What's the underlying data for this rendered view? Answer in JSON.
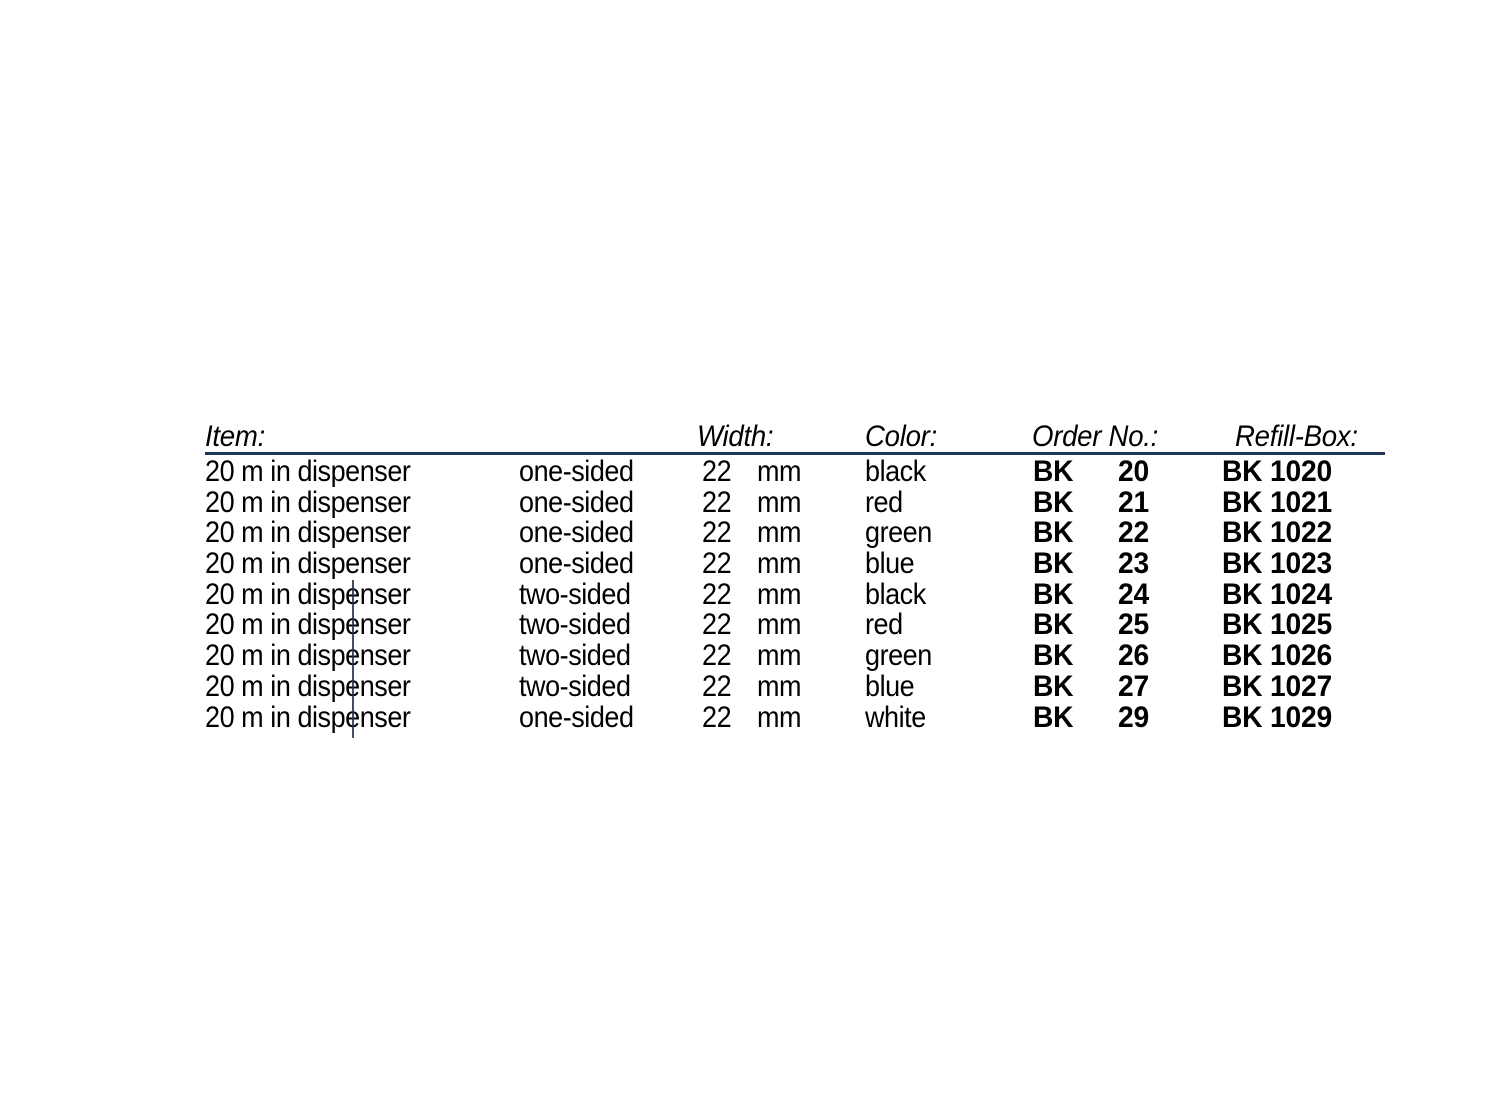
{
  "page": {
    "background_color": "#ffffff",
    "text_color": "#000000",
    "rule_color": "#1d3557"
  },
  "table": {
    "headers": {
      "item": "Item:",
      "width": "Width:",
      "color": "Color:",
      "order_no": "Order No.:",
      "refill_box": "Refill-Box:"
    },
    "rows": [
      {
        "item": "20 m in dispenser",
        "sided": "one-sided",
        "width_value": "22",
        "width_unit": "mm",
        "color": "black",
        "order_prefix": "BK",
        "order_number": "20",
        "refill_box": "BK 1020"
      },
      {
        "item": "20 m in dispenser",
        "sided": "one-sided",
        "width_value": "22",
        "width_unit": "mm",
        "color": "red",
        "order_prefix": "BK",
        "order_number": "21",
        "refill_box": "BK 1021"
      },
      {
        "item": "20 m in dispenser",
        "sided": "one-sided",
        "width_value": "22",
        "width_unit": "mm",
        "color": "green",
        "order_prefix": "BK",
        "order_number": "22",
        "refill_box": "BK 1022"
      },
      {
        "item": "20 m in dispenser",
        "sided": "one-sided",
        "width_value": "22",
        "width_unit": "mm",
        "color": "blue",
        "order_prefix": "BK",
        "order_number": "23",
        "refill_box": "BK 1023"
      },
      {
        "item": "20 m in dispenser",
        "sided": "two-sided",
        "width_value": "22",
        "width_unit": "mm",
        "color": "black",
        "order_prefix": "BK",
        "order_number": "24",
        "refill_box": "BK 1024"
      },
      {
        "item": "20 m in dispenser",
        "sided": "two-sided",
        "width_value": "22",
        "width_unit": "mm",
        "color": "red",
        "order_prefix": "BK",
        "order_number": "25",
        "refill_box": "BK 1025"
      },
      {
        "item": "20 m in dispenser",
        "sided": "two-sided",
        "width_value": "22",
        "width_unit": "mm",
        "color": "green",
        "order_prefix": "BK",
        "order_number": "26",
        "refill_box": "BK 1026"
      },
      {
        "item": "20 m in dispenser",
        "sided": "two-sided",
        "width_value": "22",
        "width_unit": "mm",
        "color": "blue",
        "order_prefix": "BK",
        "order_number": "27",
        "refill_box": "BK 1027"
      },
      {
        "item": "20 m in dispenser",
        "sided": "one-sided",
        "width_value": "22",
        "width_unit": "mm",
        "color": "white",
        "order_prefix": "BK",
        "order_number": "29",
        "refill_box": "BK 1029"
      }
    ]
  }
}
